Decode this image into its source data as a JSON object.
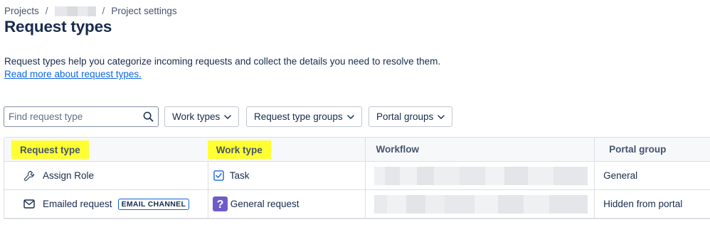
{
  "breadcrumb": {
    "projects": "Projects",
    "separator": "/",
    "current": "Project settings"
  },
  "page_title": "Request types",
  "description": "Request types help you categorize incoming requests and collect the details you need to resolve them.",
  "read_more_link": "Read more about request types.",
  "search": {
    "placeholder": "Find request type",
    "value": "",
    "icon": "search-icon"
  },
  "filters": [
    {
      "label": "Work types",
      "icon": "chevron-down-icon"
    },
    {
      "label": "Request type groups",
      "icon": "chevron-down-icon"
    },
    {
      "label": "Portal groups",
      "icon": "chevron-down-icon"
    }
  ],
  "table": {
    "columns": [
      "Request type",
      "Work type",
      "Workflow",
      "Portal group"
    ],
    "highlight_color": "#ffff32",
    "rows": [
      {
        "request_type": "Assign Role",
        "request_type_icon": "wrench-icon",
        "badge": "",
        "work_type": "Task",
        "work_type_icon": "checkbox-task-icon",
        "portal_group": "General"
      },
      {
        "request_type": "Emailed request",
        "request_type_icon": "envelope-icon",
        "badge": "EMAIL CHANNEL",
        "work_type": "General request",
        "work_type_icon": "question-mark-icon",
        "portal_group": "Hidden from portal"
      }
    ]
  },
  "colors": {
    "link": "#0c66e4",
    "text": "#172b4d",
    "subtle_text": "#44546f",
    "task_icon": "#1868db",
    "question_icon_bg": "#6e5dc6"
  }
}
